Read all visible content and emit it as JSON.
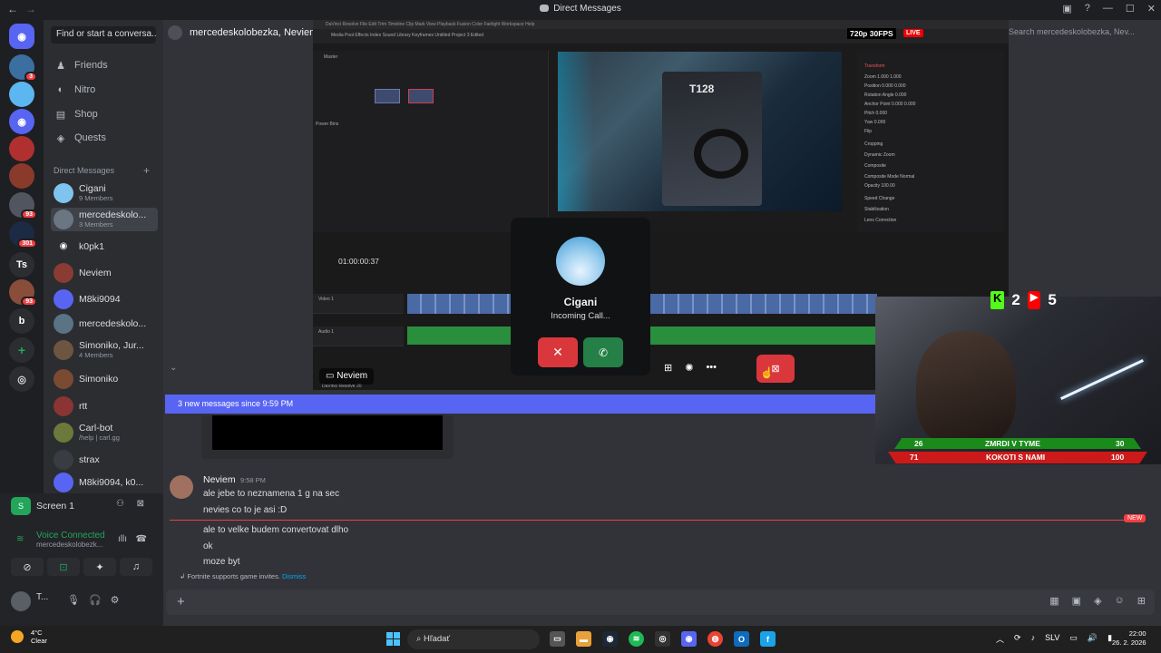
{
  "window": {
    "title": "Direct Messages"
  },
  "nav": {
    "find_placeholder": "Find or start a conversa...",
    "items": [
      {
        "label": "Friends",
        "icon": "people-icon"
      },
      {
        "label": "Nitro",
        "icon": "nitro-icon"
      },
      {
        "label": "Shop",
        "icon": "shop-icon"
      },
      {
        "label": "Quests",
        "icon": "quests-icon"
      }
    ]
  },
  "servers": {
    "badges": [
      "3",
      "93",
      "301",
      "93"
    ],
    "labels": [
      "Ts",
      "b"
    ]
  },
  "dm_list": {
    "heading": "Direct Messages",
    "items": [
      {
        "name": "Cigani",
        "sub": "9 Members"
      },
      {
        "name": "mercedeskolo...",
        "sub": "3 Members"
      },
      {
        "name": "k0pk1",
        "sub": ""
      },
      {
        "name": "Neviem",
        "sub": ""
      },
      {
        "name": "M8ki9094",
        "sub": ""
      },
      {
        "name": "mercedeskolo...",
        "sub": "Simoniko, Jur..."
      },
      {
        "name": "Simoniko, Jur...",
        "sub": "4 Members"
      },
      {
        "name": "Simoniko",
        "sub": ""
      },
      {
        "name": "rtt",
        "sub": ""
      },
      {
        "name": "Carl-bot",
        "sub": "/help | carl.gg"
      },
      {
        "name": "strax",
        "sub": ""
      },
      {
        "name": "M8ki9094, k0...",
        "sub": ""
      }
    ]
  },
  "user_panel": {
    "screen_label": "Screen 1",
    "voice_status": "Voice Connected",
    "voice_channel": "mercedeskolobezk...",
    "me_name": "T..."
  },
  "chat": {
    "header_name": "mercedeskolobezka, Neviem",
    "search_placeholder": "Search mercedeskolobezka, Nev...",
    "new_messages_bar": "3 new messages since 9:59 PM",
    "message": {
      "author": "Neviem",
      "time": "9:58 PM",
      "lines": [
        "ale jebe to neznamena 1 g na sec",
        "nevies co to je asi :D",
        "ale to velke budem convertovat dlho",
        "ok",
        "moze byt"
      ]
    },
    "new_badge": "NEW",
    "hint_text": "Fortnite supports game invites.",
    "hint_link": "Dismiss"
  },
  "call": {
    "name": "Cigani",
    "status": "Incoming Call...",
    "voice_tile_name": "Neviem"
  },
  "resolve": {
    "menu": "DaVinci Resolve   File   Edit   Trim   Timeline   Clip   Mark   View   Playback   Fusion   Color   Fairlight   Workspace   Help",
    "toolbar": "Media Pool     Effects     Index     Sound Library     Keyframes                                   Untitled Project 3        Edited",
    "timecode": "01:00:00:37",
    "pool_tab": "Master",
    "power_bins": "Power Bins",
    "box_text": "T128",
    "inspector": [
      "Transform",
      "Zoom   1.000   1.000",
      "Position   0.000   0.000",
      "Rotation Angle   0.000",
      "Anchor Point   0.000   0.000",
      "Pitch   0.000",
      "Yaw   0.000",
      "Flip",
      "Cropping",
      "Dynamic Zoom",
      "Composite",
      "Composite Mode  Normal",
      "Opacity  100.00",
      "Speed Change",
      "Stabilization",
      "Lens Correction"
    ],
    "track_video": "Video 1",
    "track_audio": "Audio 1",
    "bottom_label": "DaVinci Resolve 20"
  },
  "stream_overlay": {
    "quality": "720p 30FPS",
    "live": "LIVE",
    "kick_count": "2",
    "youtube_count": "5",
    "bar1_left": "26",
    "bar1_label": "ZMRDI V TYME",
    "bar1_right": "30",
    "bar2_left": "71",
    "bar2_label": "KOKOTI S NAMI",
    "bar2_right": "100"
  },
  "taskbar": {
    "temp": "4°C",
    "weather": "Clear",
    "search": "Hľadať",
    "lang": "SLV",
    "time": "22:00",
    "date": "26. 2. 2026"
  },
  "colors": {
    "blurple": "#5865f2",
    "red": "#da373c",
    "green": "#248046",
    "bg": "#313338"
  }
}
